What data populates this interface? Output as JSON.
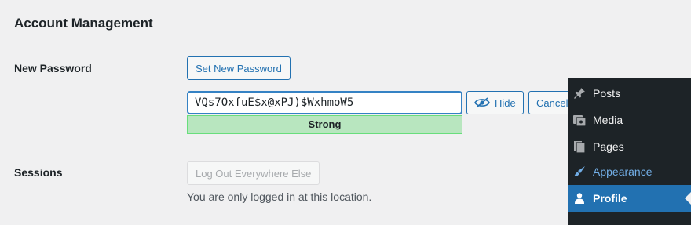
{
  "section": {
    "title": "Account Management"
  },
  "new_password": {
    "label": "New Password",
    "set_button": "Set New Password",
    "value": "VQs7OxfuE$x@xPJ)$WxhmoW5",
    "strength": "Strong",
    "hide_button": "Hide",
    "cancel_button": "Cancel"
  },
  "sessions": {
    "label": "Sessions",
    "logout_button": "Log Out Everywhere Else",
    "description": "You are only logged in at this location."
  },
  "admin_menu": {
    "items": [
      {
        "label": "Posts",
        "icon": "pushpin-icon"
      },
      {
        "label": "Media",
        "icon": "media-icon"
      },
      {
        "label": "Pages",
        "icon": "pages-icon"
      },
      {
        "label": "Appearance",
        "icon": "paintbrush-icon"
      },
      {
        "label": "Profile",
        "icon": "user-icon"
      }
    ]
  },
  "colors": {
    "accent": "#2271b1",
    "strong_bg": "#b8e6bf",
    "menu_bg": "#1d2327",
    "menu_hover": "#72aee6"
  }
}
